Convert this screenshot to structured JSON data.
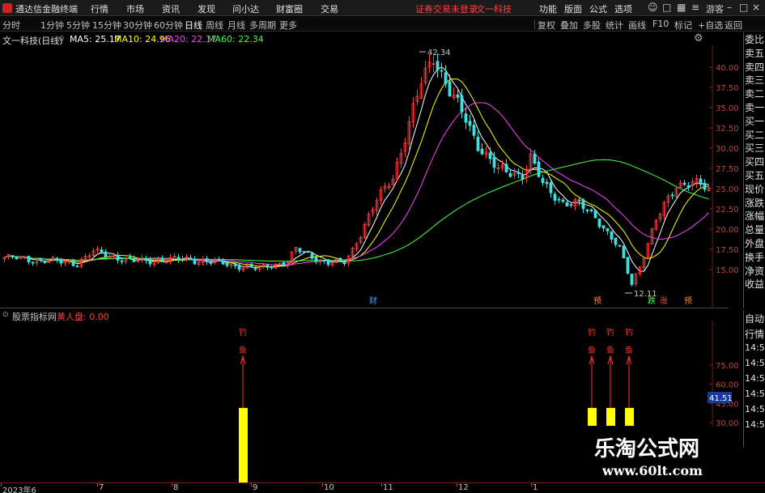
{
  "app": {
    "name": "通达信金融终端",
    "menus": [
      "行情",
      "市场",
      "资讯",
      "发现",
      "问小达",
      "财富圈",
      "交易"
    ],
    "notice": "证券交易未登录",
    "stock_name_top": "文一科技",
    "right_menus": [
      "功能",
      "版面",
      "公式",
      "选项"
    ],
    "guest": "游客"
  },
  "toolbar": {
    "periods": [
      "分时",
      "1分钟",
      "5分钟",
      "15分钟",
      "30分钟",
      "60分钟",
      "日线",
      "周线",
      "月线",
      "多周期",
      "更多"
    ],
    "active_period": "日线",
    "right_buttons": [
      "复权",
      "叠加",
      "多股",
      "统计",
      "画线",
      "F10",
      "标记",
      "+自选",
      "返回"
    ]
  },
  "legend": {
    "title": "文一科技(日线)",
    "ma5": "MA5: 25.17",
    "ma10": "MA10: 24.96",
    "ma20": "MA20: 22.17",
    "ma60": "MA60: 22.34"
  },
  "colors": {
    "up": "#ff3c3c",
    "down": "#40e0e0",
    "ma5": "#ffffff",
    "ma10": "#ffff00",
    "ma20": "#ff40ff",
    "ma60": "#40ff40",
    "signal_bar": "#ffff00"
  },
  "price_axis": {
    "ticks": [
      "40.00",
      "37.50",
      "35.00",
      "32.50",
      "30.00",
      "27.50",
      "25.00",
      "22.50",
      "20.00",
      "17.50",
      "15.00"
    ],
    "high_label": "42.34",
    "low_label": "12.11"
  },
  "right_panel": {
    "items": [
      "委比",
      "卖五",
      "卖四",
      "卖三",
      "卖二",
      "卖一",
      "买一",
      "买二",
      "买三",
      "买四",
      "买五",
      "现价",
      "涨跌",
      "涨幅",
      "总量",
      "外盘",
      "换手",
      "净资",
      "收益"
    ],
    "items2": [
      "自动",
      "行情",
      "14:5(",
      "14:5(",
      "14:5(",
      "14:5(",
      "14:5(",
      "14:5("
    ]
  },
  "event_markers": [
    {
      "label": "财",
      "color": "#4aa0ff"
    },
    {
      "label": "预",
      "color": "#ff8030"
    },
    {
      "label": "跌",
      "color": "#40ff40"
    },
    {
      "label": "涨",
      "color": "#ff4040"
    },
    {
      "label": "预",
      "color": "#ff8030"
    }
  ],
  "indicator": {
    "name": "股票指标网",
    "series_label": "黄人盘: 0.00",
    "axis_ticks": [
      "75.00",
      "60.00",
      "45.00",
      "30.00"
    ],
    "current_value": "41.51",
    "signal_text": "钓鱼"
  },
  "date_axis": [
    "2023年6",
    "7",
    "8",
    "9",
    "10",
    "11",
    "12",
    "1"
  ],
  "watermark": {
    "line1": "乐淘公式网",
    "line2": "www.60lt.com"
  },
  "chart_data": {
    "type": "candlestick",
    "title": "文一科技(日线)",
    "y_range": [
      12.11,
      42.34
    ],
    "ma_latest": {
      "MA5": 25.17,
      "MA10": 24.96,
      "MA20": 22.17,
      "MA60": 22.34
    },
    "high": 42.34,
    "low": 12.11,
    "indicator_signals": {
      "count": 4,
      "value_when_triggered": 41.51,
      "indicator_range": [
        30,
        75
      ]
    }
  }
}
